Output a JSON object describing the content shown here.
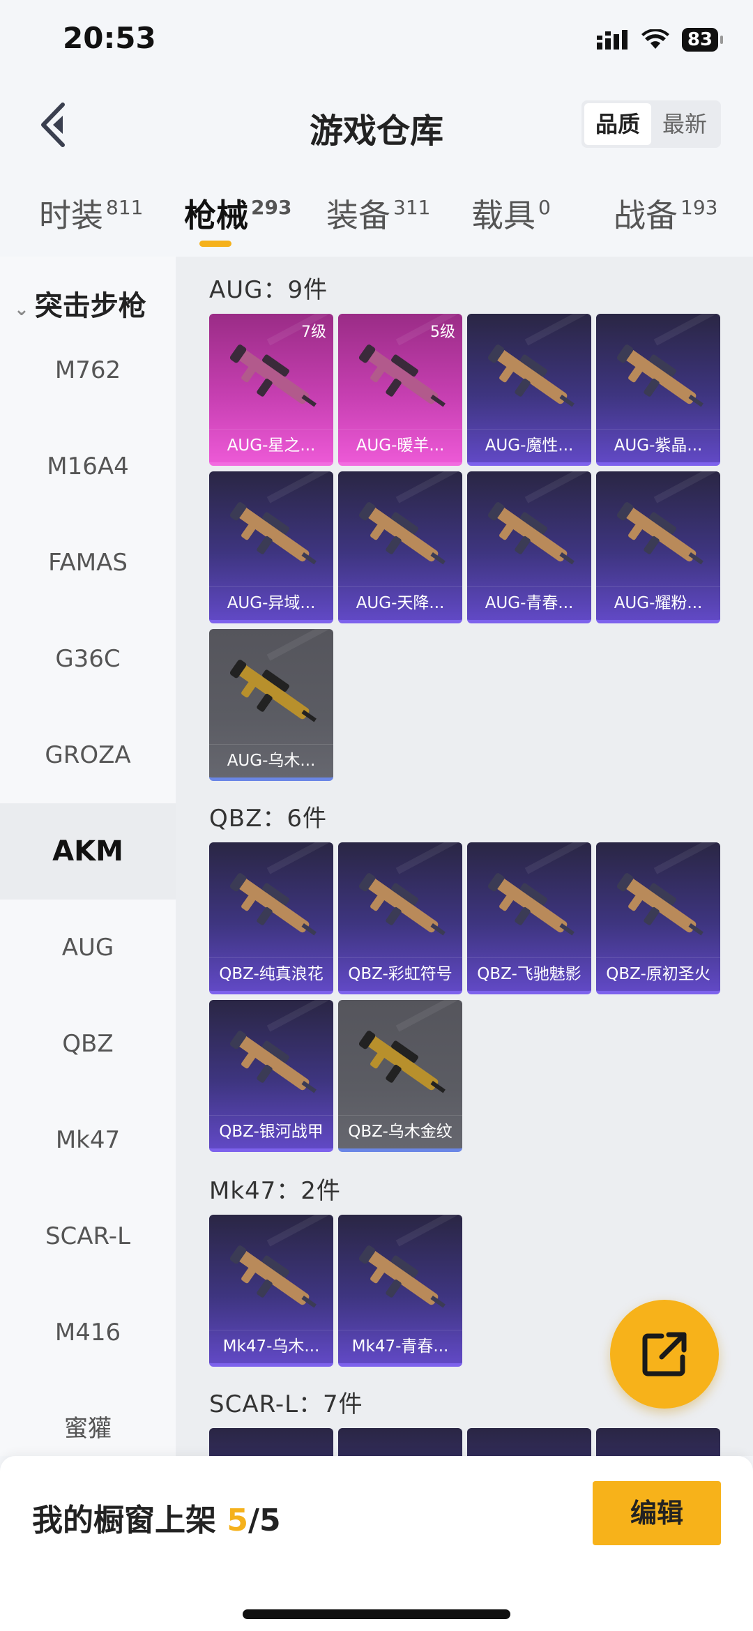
{
  "status": {
    "time": "20:53",
    "battery": "83"
  },
  "header": {
    "title": "游戏仓库",
    "sort_options": [
      "品质",
      "最新"
    ]
  },
  "tabs": [
    {
      "label": "时装",
      "count": "811"
    },
    {
      "label": "枪械",
      "count": "293"
    },
    {
      "label": "装备",
      "count": "311"
    },
    {
      "label": "载具",
      "count": "0"
    },
    {
      "label": "战备",
      "count": "193"
    }
  ],
  "sidebar": {
    "category": "突击步枪",
    "items": [
      "M762",
      "M16A4",
      "FAMAS",
      "G36C",
      "GROZA",
      "AKM",
      "AUG",
      "QBZ",
      "Mk47",
      "SCAR-L",
      "M416",
      "蜜獾"
    ],
    "active": "AKM"
  },
  "groups": [
    {
      "title": "AUG：9件",
      "items": [
        {
          "name": "AUG-星之...",
          "level": "7级",
          "rarity": "pink"
        },
        {
          "name": "AUG-暖羊...",
          "level": "5级",
          "rarity": "pink"
        },
        {
          "name": "AUG-魔性...",
          "rarity": "purple"
        },
        {
          "name": "AUG-紫晶...",
          "rarity": "purple"
        },
        {
          "name": "AUG-异域...",
          "rarity": "purple"
        },
        {
          "name": "AUG-天降...",
          "rarity": "purple"
        },
        {
          "name": "AUG-青春...",
          "rarity": "purple"
        },
        {
          "name": "AUG-耀粉...",
          "rarity": "purple"
        },
        {
          "name": "AUG-乌木...",
          "rarity": "gray"
        }
      ]
    },
    {
      "title": "QBZ：6件",
      "items": [
        {
          "name": "QBZ-纯真浪花",
          "rarity": "purple"
        },
        {
          "name": "QBZ-彩虹符号",
          "rarity": "purple"
        },
        {
          "name": "QBZ-飞驰魅影",
          "rarity": "purple"
        },
        {
          "name": "QBZ-原初圣火",
          "rarity": "purple"
        },
        {
          "name": "QBZ-银河战甲",
          "rarity": "purple"
        },
        {
          "name": "QBZ-乌木金纹",
          "rarity": "gray"
        }
      ]
    },
    {
      "title": "Mk47：2件",
      "items": [
        {
          "name": "Mk47-乌木...",
          "rarity": "purple"
        },
        {
          "name": "Mk47-青春...",
          "rarity": "purple"
        }
      ]
    },
    {
      "title": "SCAR-L：7件",
      "items": []
    }
  ],
  "bottom": {
    "label": "我的橱窗上架",
    "current": "5",
    "total": "/5",
    "edit": "编辑"
  }
}
